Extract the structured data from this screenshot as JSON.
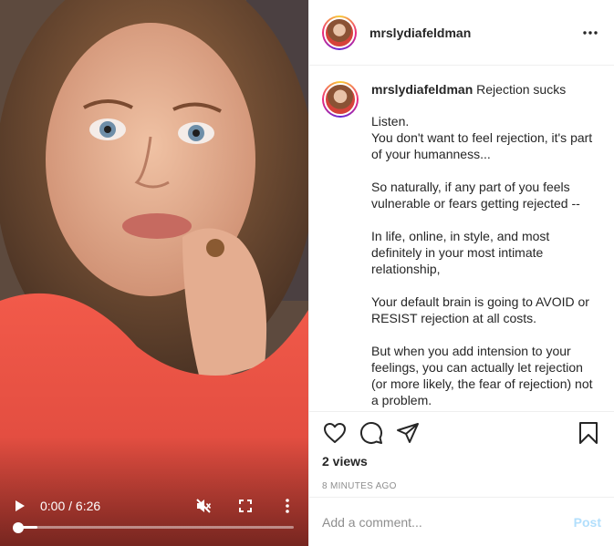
{
  "post": {
    "username": "mrslydiafeldman",
    "more_label": "•••"
  },
  "video": {
    "time": "0:00 / 6:26",
    "progress": 0.07
  },
  "caption": {
    "username": "mrslydiafeldman",
    "title": "Rejection sucks",
    "paragraphs": [
      "Listen.\nYou don't want to feel rejection, it's part of your humanness...",
      "So naturally, if any part of you feels vulnerable or fears getting rejected --",
      "In life, online, in style, and most definitely in your most intimate relationship,",
      "Your default brain is going to AVOID or RESIST rejection at all costs.",
      "But when you add intension to your feelings, you can actually let rejection (or more likely, the fear of rejection) not a problem."
    ]
  },
  "stats": {
    "views": "2 views",
    "time_ago": "8 MINUTES AGO"
  },
  "comment_box": {
    "placeholder": "Add a comment...",
    "post_label": "Post"
  },
  "colors": {
    "post_disabled": "#b2dffc",
    "muted_text": "#8e8e8e",
    "border": "#efefef"
  }
}
